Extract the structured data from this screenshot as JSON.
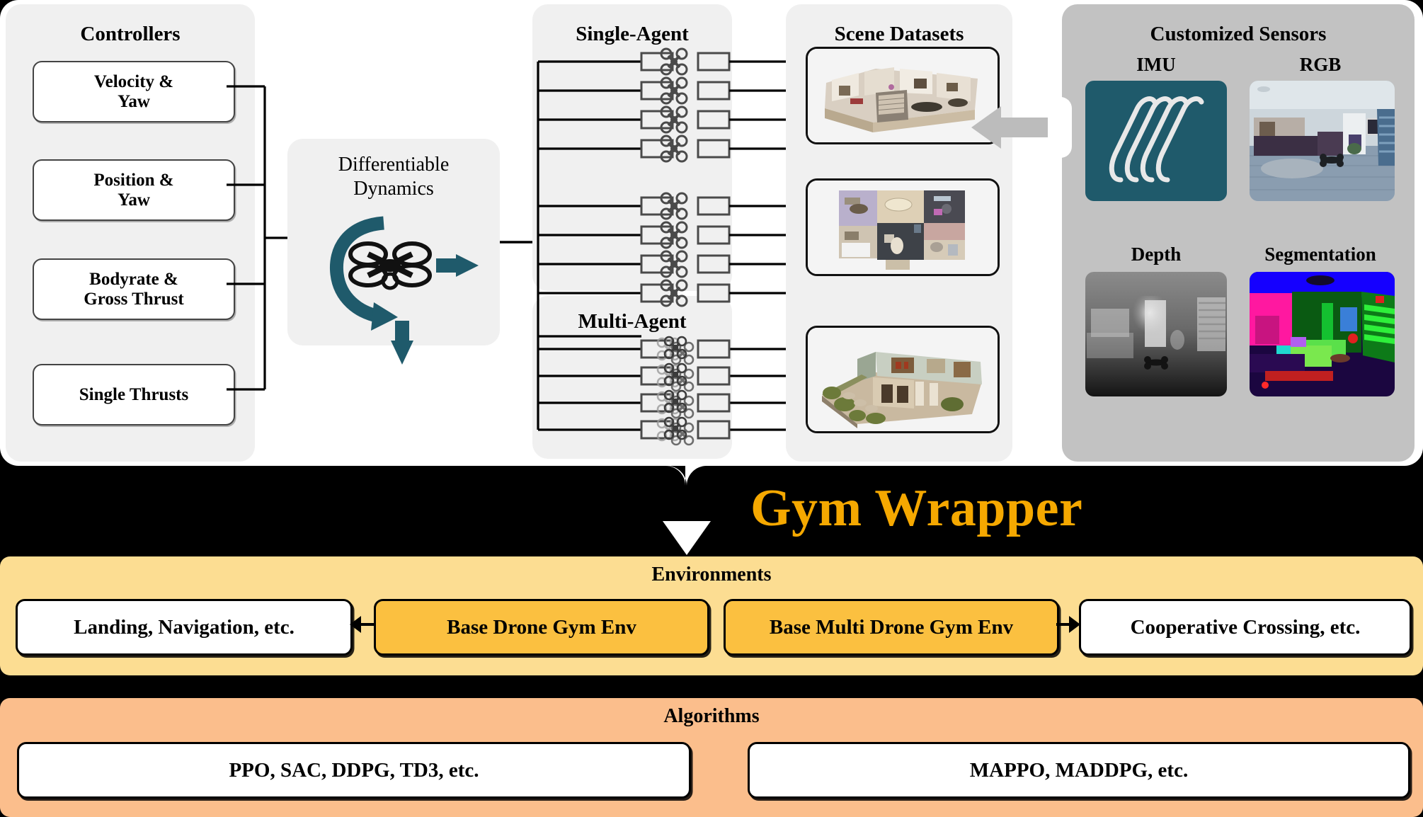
{
  "controllers": {
    "title": "Controllers",
    "items": [
      {
        "label": "Velocity &\nYaw"
      },
      {
        "label": "Position &\nYaw"
      },
      {
        "label": "Bodyrate &\nGross Thrust"
      },
      {
        "label": "Single Thrusts"
      }
    ]
  },
  "dynamics": {
    "title": "Differentiable\nDynamics",
    "icon": "drone-rotation-icon",
    "accent_color": "#1F5A6B"
  },
  "single_agent": {
    "title": "Single-Agent",
    "row_count": 8,
    "icon": "quadcopter-icon"
  },
  "multi_agent": {
    "title": "Multi-Agent",
    "row_count": 4,
    "icon": "quadcopter-swarm-icon"
  },
  "scenes": {
    "title": "Scene Datasets",
    "cards": [
      {
        "name": "multi-floor-house-scan"
      },
      {
        "name": "top-down-apartment-scan"
      },
      {
        "name": "house-with-garden-scan"
      }
    ]
  },
  "sensors": {
    "title": "Customized Sensors",
    "panel_color": "#C2C2C2",
    "items": [
      {
        "label": "IMU",
        "type": "imu-waveform",
        "color": "#1F5A6B"
      },
      {
        "label": "RGB",
        "type": "rgb-room-image"
      },
      {
        "label": "Depth",
        "type": "depth-map-image"
      },
      {
        "label": "Segmentation",
        "type": "segmentation-image"
      }
    ]
  },
  "gym_wrapper": {
    "title": "Gym Wrapper",
    "text_color": "#F5A800",
    "band_color": "#000000",
    "arrow": "down-arrow-icon"
  },
  "environments": {
    "title": "Environments",
    "background_color": "#FCDD92",
    "boxes": [
      {
        "label": "Landing, Navigation, etc.",
        "style": "white"
      },
      {
        "label": "Base Drone Gym Env",
        "style": "amber"
      },
      {
        "label": "Base Multi Drone Gym Env",
        "style": "amber"
      },
      {
        "label": "Cooperative Crossing, etc.",
        "style": "white"
      }
    ]
  },
  "algorithms": {
    "title": "Algorithms",
    "background_color": "#FBBE8C",
    "boxes": [
      {
        "label": "PPO, SAC, DDPG, TD3, etc."
      },
      {
        "label": "MAPPO, MADDPG, etc."
      }
    ]
  }
}
